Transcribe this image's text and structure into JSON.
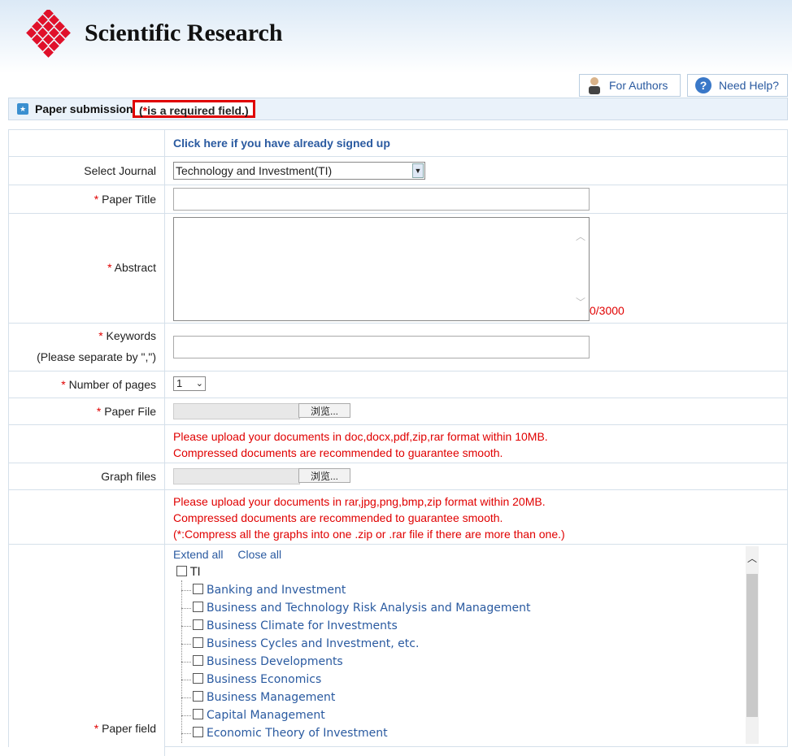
{
  "header": {
    "site_title": "Scientific Research",
    "logo_icon": "diamond-grid-logo"
  },
  "top_links": {
    "for_authors": "For Authors",
    "need_help": "Need Help?"
  },
  "section_bar": {
    "title": "Paper submission",
    "required_note_star": "*",
    "required_note_text": "is a required field.)",
    "required_note_paren": "("
  },
  "form": {
    "signup_link": "Click here if you have already signed up",
    "journal_label": "Select Journal",
    "journal_value": "Technology and Investment(TI)",
    "title_label": "Paper Title",
    "abstract_label": "Abstract",
    "abstract_counter": "0/3000",
    "keywords_label": "Keywords",
    "keywords_hint": "(Please separate by \",\")",
    "pages_label": "Number of pages",
    "pages_value": "1",
    "paper_file_label": "Paper File",
    "browse_button": "浏览...",
    "paper_note_1": "Please upload your documents in doc,docx,pdf,zip,rar format within 10MB.",
    "paper_note_2": "Compressed documents are recommended to guarantee smooth.",
    "graph_label": "Graph files",
    "graph_note_1": "Please upload your documents in rar,jpg,png,bmp,zip format within 20MB.",
    "graph_note_2": "Compressed documents are recommended to guarantee smooth.",
    "graph_note_3": "(*:Compress all the graphs into one .zip or .rar file if there are more than one.)",
    "field_label": "Paper field",
    "required_star": "*"
  },
  "tree": {
    "extend_all": "Extend all",
    "close_all": "Close all",
    "root": "TI",
    "items": [
      "Banking and Investment",
      "Business and Technology Risk Analysis and Management",
      "Business Climate for Investments",
      "Business Cycles and Investment, etc.",
      "Business Developments",
      "Business Economics",
      "Business Management",
      "Capital Management",
      "Economic Theory of Investment"
    ]
  }
}
